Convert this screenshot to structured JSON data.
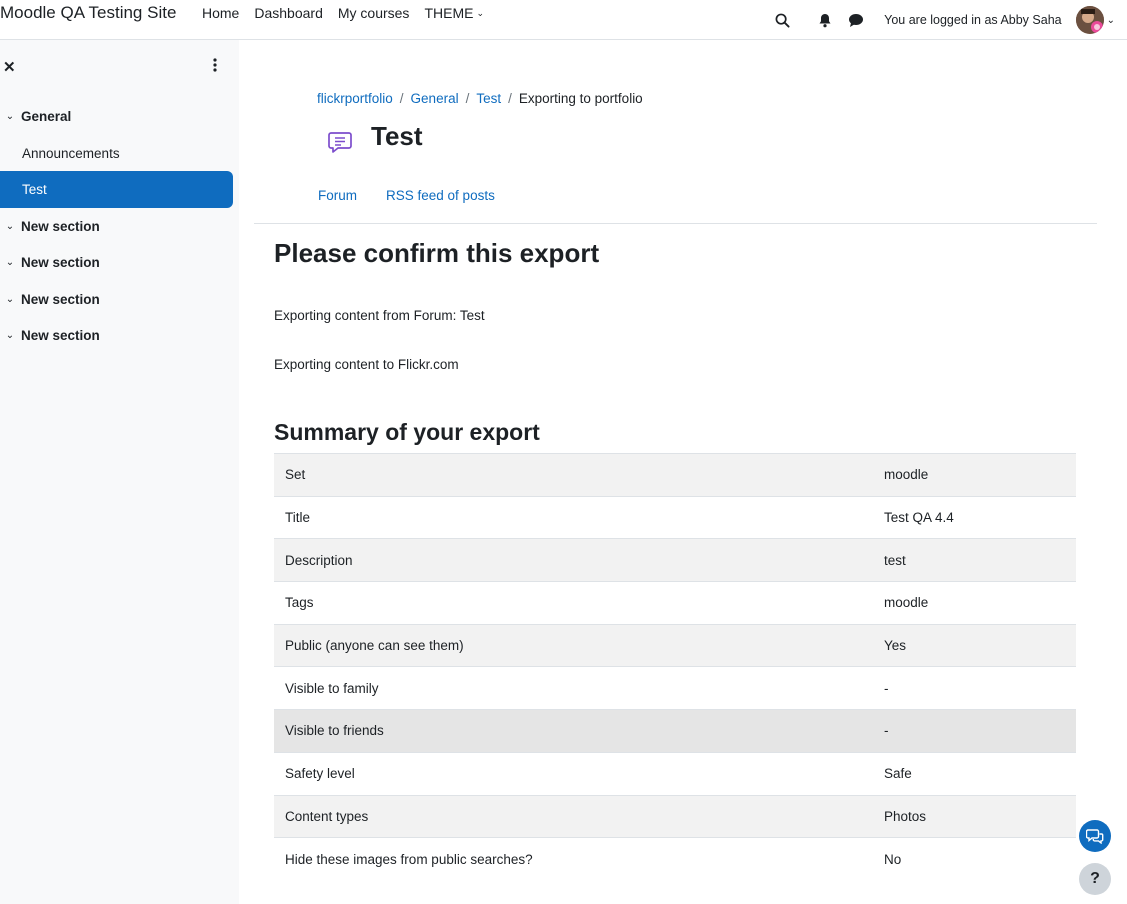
{
  "navbar": {
    "site_name": "Moodle QA Testing Site",
    "links": [
      "Home",
      "Dashboard",
      "My courses",
      "THEME"
    ],
    "logged_in_text": "You are logged in as Abby Saha"
  },
  "drawer": {
    "sections": [
      {
        "label": "General",
        "expanded": true,
        "items": [
          "Announcements",
          "Test"
        ]
      },
      {
        "label": "New section"
      },
      {
        "label": "New section"
      },
      {
        "label": "New section"
      },
      {
        "label": "New section"
      }
    ],
    "active_item": "Test"
  },
  "breadcrumb": {
    "items": [
      "flickrportfolio",
      "General",
      "Test"
    ],
    "current": "Exporting to portfolio"
  },
  "page": {
    "title": "Test",
    "tabs": [
      "Forum",
      "RSS feed of posts"
    ],
    "confirm_heading": "Please confirm this export",
    "export_from": "Exporting content from Forum: Test",
    "export_to": "Exporting content to Flickr.com",
    "summary_heading": "Summary of your export"
  },
  "summary": [
    {
      "label": "Set",
      "value": "moodle"
    },
    {
      "label": "Title",
      "value": "Test QA 4.4"
    },
    {
      "label": "Description",
      "value": "test"
    },
    {
      "label": "Tags",
      "value": "moodle"
    },
    {
      "label": "Public (anyone can see them)",
      "value": "Yes"
    },
    {
      "label": "Visible to family",
      "value": "-"
    },
    {
      "label": "Visible to friends",
      "value": "-"
    },
    {
      "label": "Safety level",
      "value": "Safe"
    },
    {
      "label": "Content types",
      "value": "Photos"
    },
    {
      "label": "Hide these images from public searches?",
      "value": "No"
    }
  ],
  "help_label": "?",
  "colors": {
    "primary": "#0f6cbf",
    "drawer_bg": "#f8f9fa",
    "forum_icon": "#7c4dcc"
  }
}
